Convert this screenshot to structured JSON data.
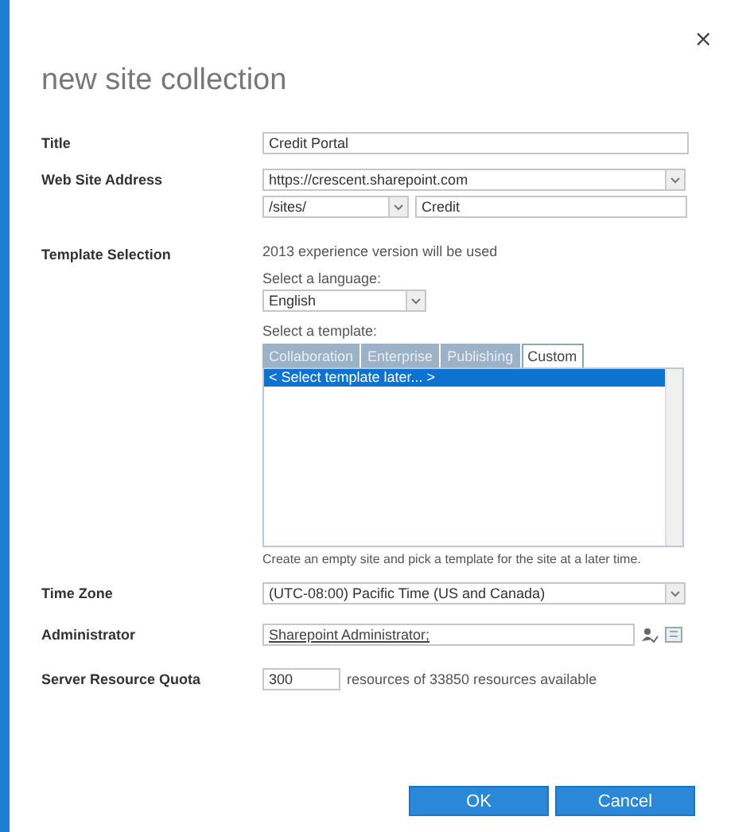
{
  "dialog": {
    "title": "new site collection",
    "close": "×"
  },
  "title_field": {
    "label": "Title",
    "value": "Credit Portal"
  },
  "web_address": {
    "label": "Web Site Address",
    "domain": "https://crescent.sharepoint.com",
    "path": "/sites/",
    "name": "Credit"
  },
  "template": {
    "label": "Template Selection",
    "note": "2013 experience version will be used",
    "language_label": "Select a language:",
    "language": "English",
    "template_label": "Select a template:",
    "tabs": [
      {
        "label": "Collaboration",
        "selected": false
      },
      {
        "label": "Enterprise",
        "selected": false
      },
      {
        "label": "Publishing",
        "selected": false
      },
      {
        "label": "Custom",
        "selected": true
      }
    ],
    "items": [
      {
        "label": "< Select template later... >",
        "selected": true
      }
    ],
    "help": "Create an empty site and pick a template for the site at a later time."
  },
  "time_zone": {
    "label": "Time Zone",
    "value": "(UTC-08:00) Pacific Time (US and Canada)"
  },
  "administrator": {
    "label": "Administrator",
    "value": "Sharepoint Administrator;"
  },
  "quota": {
    "label": "Server Resource Quota",
    "value": "300",
    "note": "resources of 33850 resources available"
  },
  "buttons": [
    "OK",
    "Cancel"
  ]
}
